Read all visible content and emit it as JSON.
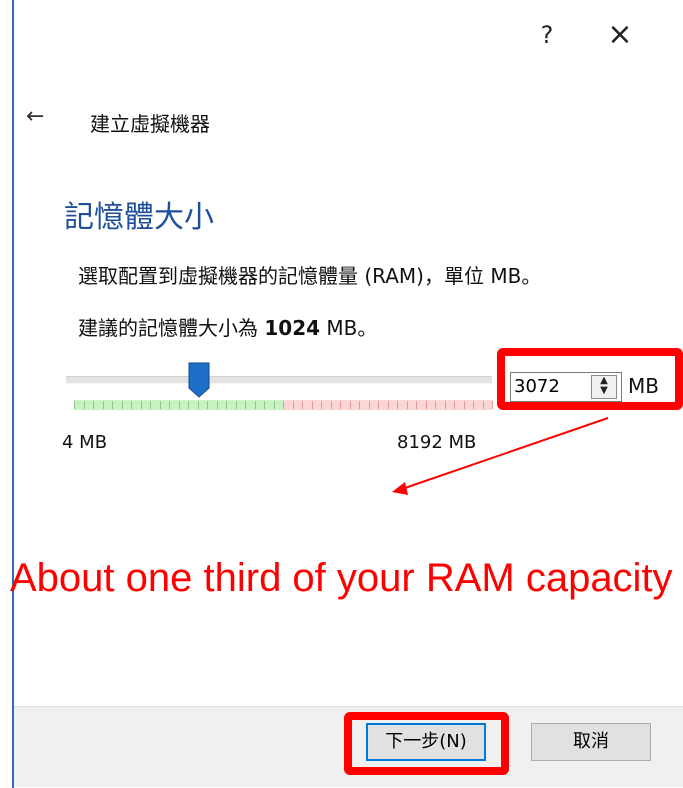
{
  "window": {
    "help_glyph": "?",
    "close_glyph": "×"
  },
  "wizard": {
    "back_glyph": "←",
    "title": "建立虛擬機器"
  },
  "page": {
    "heading": "記憶體大小",
    "description": "選取配置到虛擬機器的記憶體量 (RAM)，單位 MB。",
    "recommendation_prefix": "建議的記憶體大小為 ",
    "recommendation_value": "1024",
    "recommendation_suffix": " MB。"
  },
  "memory": {
    "value": "3072",
    "unit": "MB",
    "min_label": "4 MB",
    "max_label": "8192 MB",
    "min_mb": 4,
    "max_mb": 8192,
    "selected_mb": 3072,
    "warn_from_mb": 5120
  },
  "annotation": {
    "text": "About one third of your RAM capacity",
    "color": "#ff0000"
  },
  "footer": {
    "next_label": "下一步(N)",
    "cancel_label": "取消"
  },
  "colors": {
    "accent": "#1f4f9c",
    "thumb": "#1e6fc8",
    "highlight": "#ff0000",
    "ok_zone": "#c8f2c1",
    "warn_zone": "#fbd6d6"
  }
}
